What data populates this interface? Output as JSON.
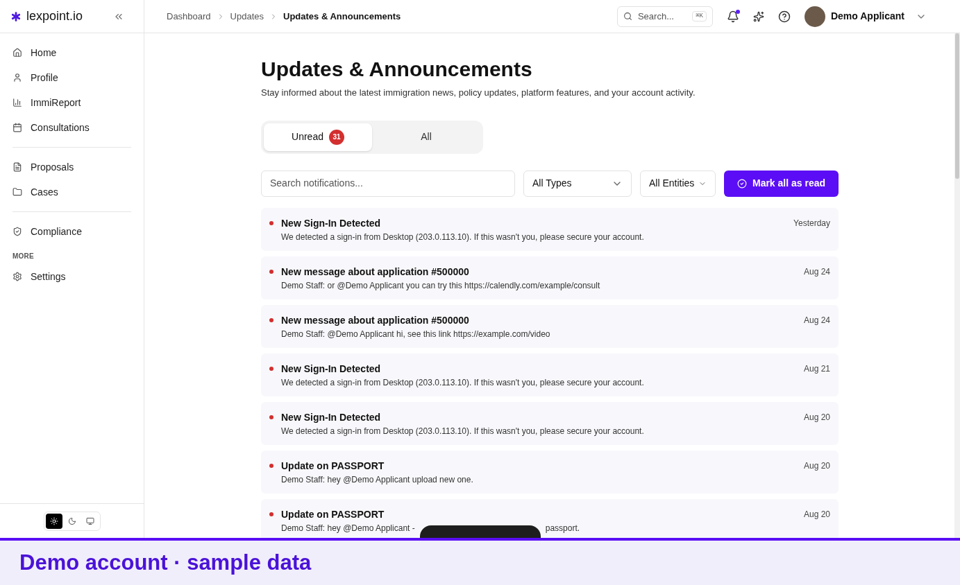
{
  "brand": {
    "name": "lexpoint.io"
  },
  "sidebar": {
    "groups": [
      {
        "items": [
          {
            "label": "Home"
          },
          {
            "label": "Profile"
          },
          {
            "label": "ImmiReport"
          },
          {
            "label": "Consultations"
          }
        ]
      },
      {
        "items": [
          {
            "label": "Proposals"
          },
          {
            "label": "Cases"
          }
        ]
      },
      {
        "items": [
          {
            "label": "Compliance"
          }
        ]
      },
      {
        "heading": "MORE",
        "items": [
          {
            "label": "Settings"
          }
        ]
      }
    ],
    "theme_options": [
      {
        "kind": "light",
        "selected": true
      },
      {
        "kind": "dark",
        "selected": false
      },
      {
        "kind": "system",
        "selected": false
      }
    ]
  },
  "breadcrumbs": [
    "Dashboard",
    "Updates",
    "Updates & Announcements"
  ],
  "topbar": {
    "search_placeholder": "Search...",
    "shortcut": "⌘K",
    "notifications_unread": true,
    "user": "Demo Applicant"
  },
  "page": {
    "title": "Updates & Announcements",
    "subtitle": "Stay informed about the latest immigration news, policy updates, platform features, and your account activity."
  },
  "tabs": [
    {
      "label": "Unread",
      "count": "31",
      "selected": true
    },
    {
      "label": "All",
      "selected": false
    }
  ],
  "filters": {
    "search_placeholder": "Search notifications...",
    "type": "All Types",
    "entity": "All Entities",
    "action": "Mark all as read"
  },
  "notifications": [
    {
      "title": "New Sign-In Detected",
      "body": "We detected a sign-in from Desktop (203.0.113.10). If this wasn't you, please secure your account.",
      "date": "Yesterday",
      "unread": true
    },
    {
      "title": "New message about application #500000",
      "body": "Demo Staff: or @Demo Applicant you can try this https://calendly.com/example/consult",
      "date": "Aug 24",
      "unread": true
    },
    {
      "title": "New message about application #500000",
      "body": "Demo Staff: @Demo Applicant hi, see this link https://example.com/video",
      "date": "Aug 24",
      "unread": true
    },
    {
      "title": "New Sign-In Detected",
      "body": "We detected a sign-in from Desktop (203.0.113.10). If this wasn't you, please secure your account.",
      "date": "Aug 21",
      "unread": true
    },
    {
      "title": "New Sign-In Detected",
      "body": "We detected a sign-in from Desktop (203.0.113.10). If this wasn't you, please secure your account.",
      "date": "Aug 20",
      "unread": true
    },
    {
      "title": "Update on PASSPORT",
      "body": "Demo Staff: hey @Demo Applicant upload new one.",
      "date": "Aug 20",
      "unread": true
    },
    {
      "title": "Update on PASSPORT",
      "body": "Demo Staff: hey @Demo Applicant -",
      "body_after": "passport.",
      "date": "Aug 20",
      "unread": true
    }
  ],
  "banner": {
    "text": "Demo account · sample data"
  }
}
